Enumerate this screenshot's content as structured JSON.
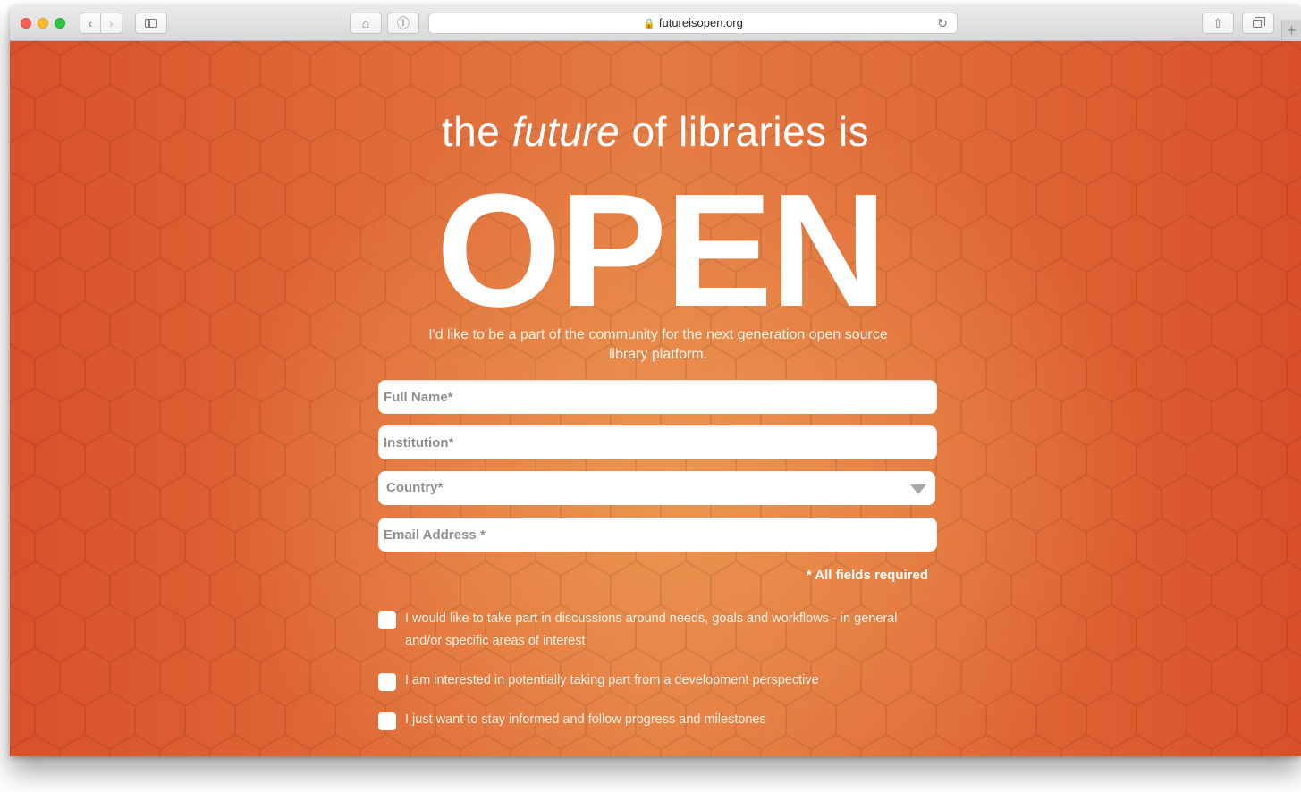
{
  "browser": {
    "url": "futureisopen.org",
    "back_label": "‹",
    "forward_label": "›",
    "home_label": "⌂",
    "privacy_label": "ⓘ",
    "reload_label": "↻",
    "share_label": "⇧",
    "new_tab_label": "+",
    "lock_label": "🔒"
  },
  "hero": {
    "headline_pre": "the ",
    "headline_em": "future",
    "headline_post": " of libraries is",
    "big_word": "OPEN",
    "tagline": "I'd like to be a part of the community for the next generation open source library platform."
  },
  "form": {
    "full_name_placeholder": "Full Name*",
    "institution_placeholder": "Institution*",
    "country_placeholder": "Country*",
    "email_placeholder": "Email Address *",
    "required_note": "* All fields required",
    "checkboxes": [
      {
        "label": "I would like to take part in discussions around needs, goals and workflows - in general and/or specific areas of interest"
      },
      {
        "label": "I am interested in potentially taking part from a development perspective"
      },
      {
        "label": "I just want to stay informed and follow progress and milestones"
      }
    ]
  },
  "colors": {
    "background_edge": "#d9502a",
    "background_center": "#ec9650",
    "text": "#ffffff"
  }
}
